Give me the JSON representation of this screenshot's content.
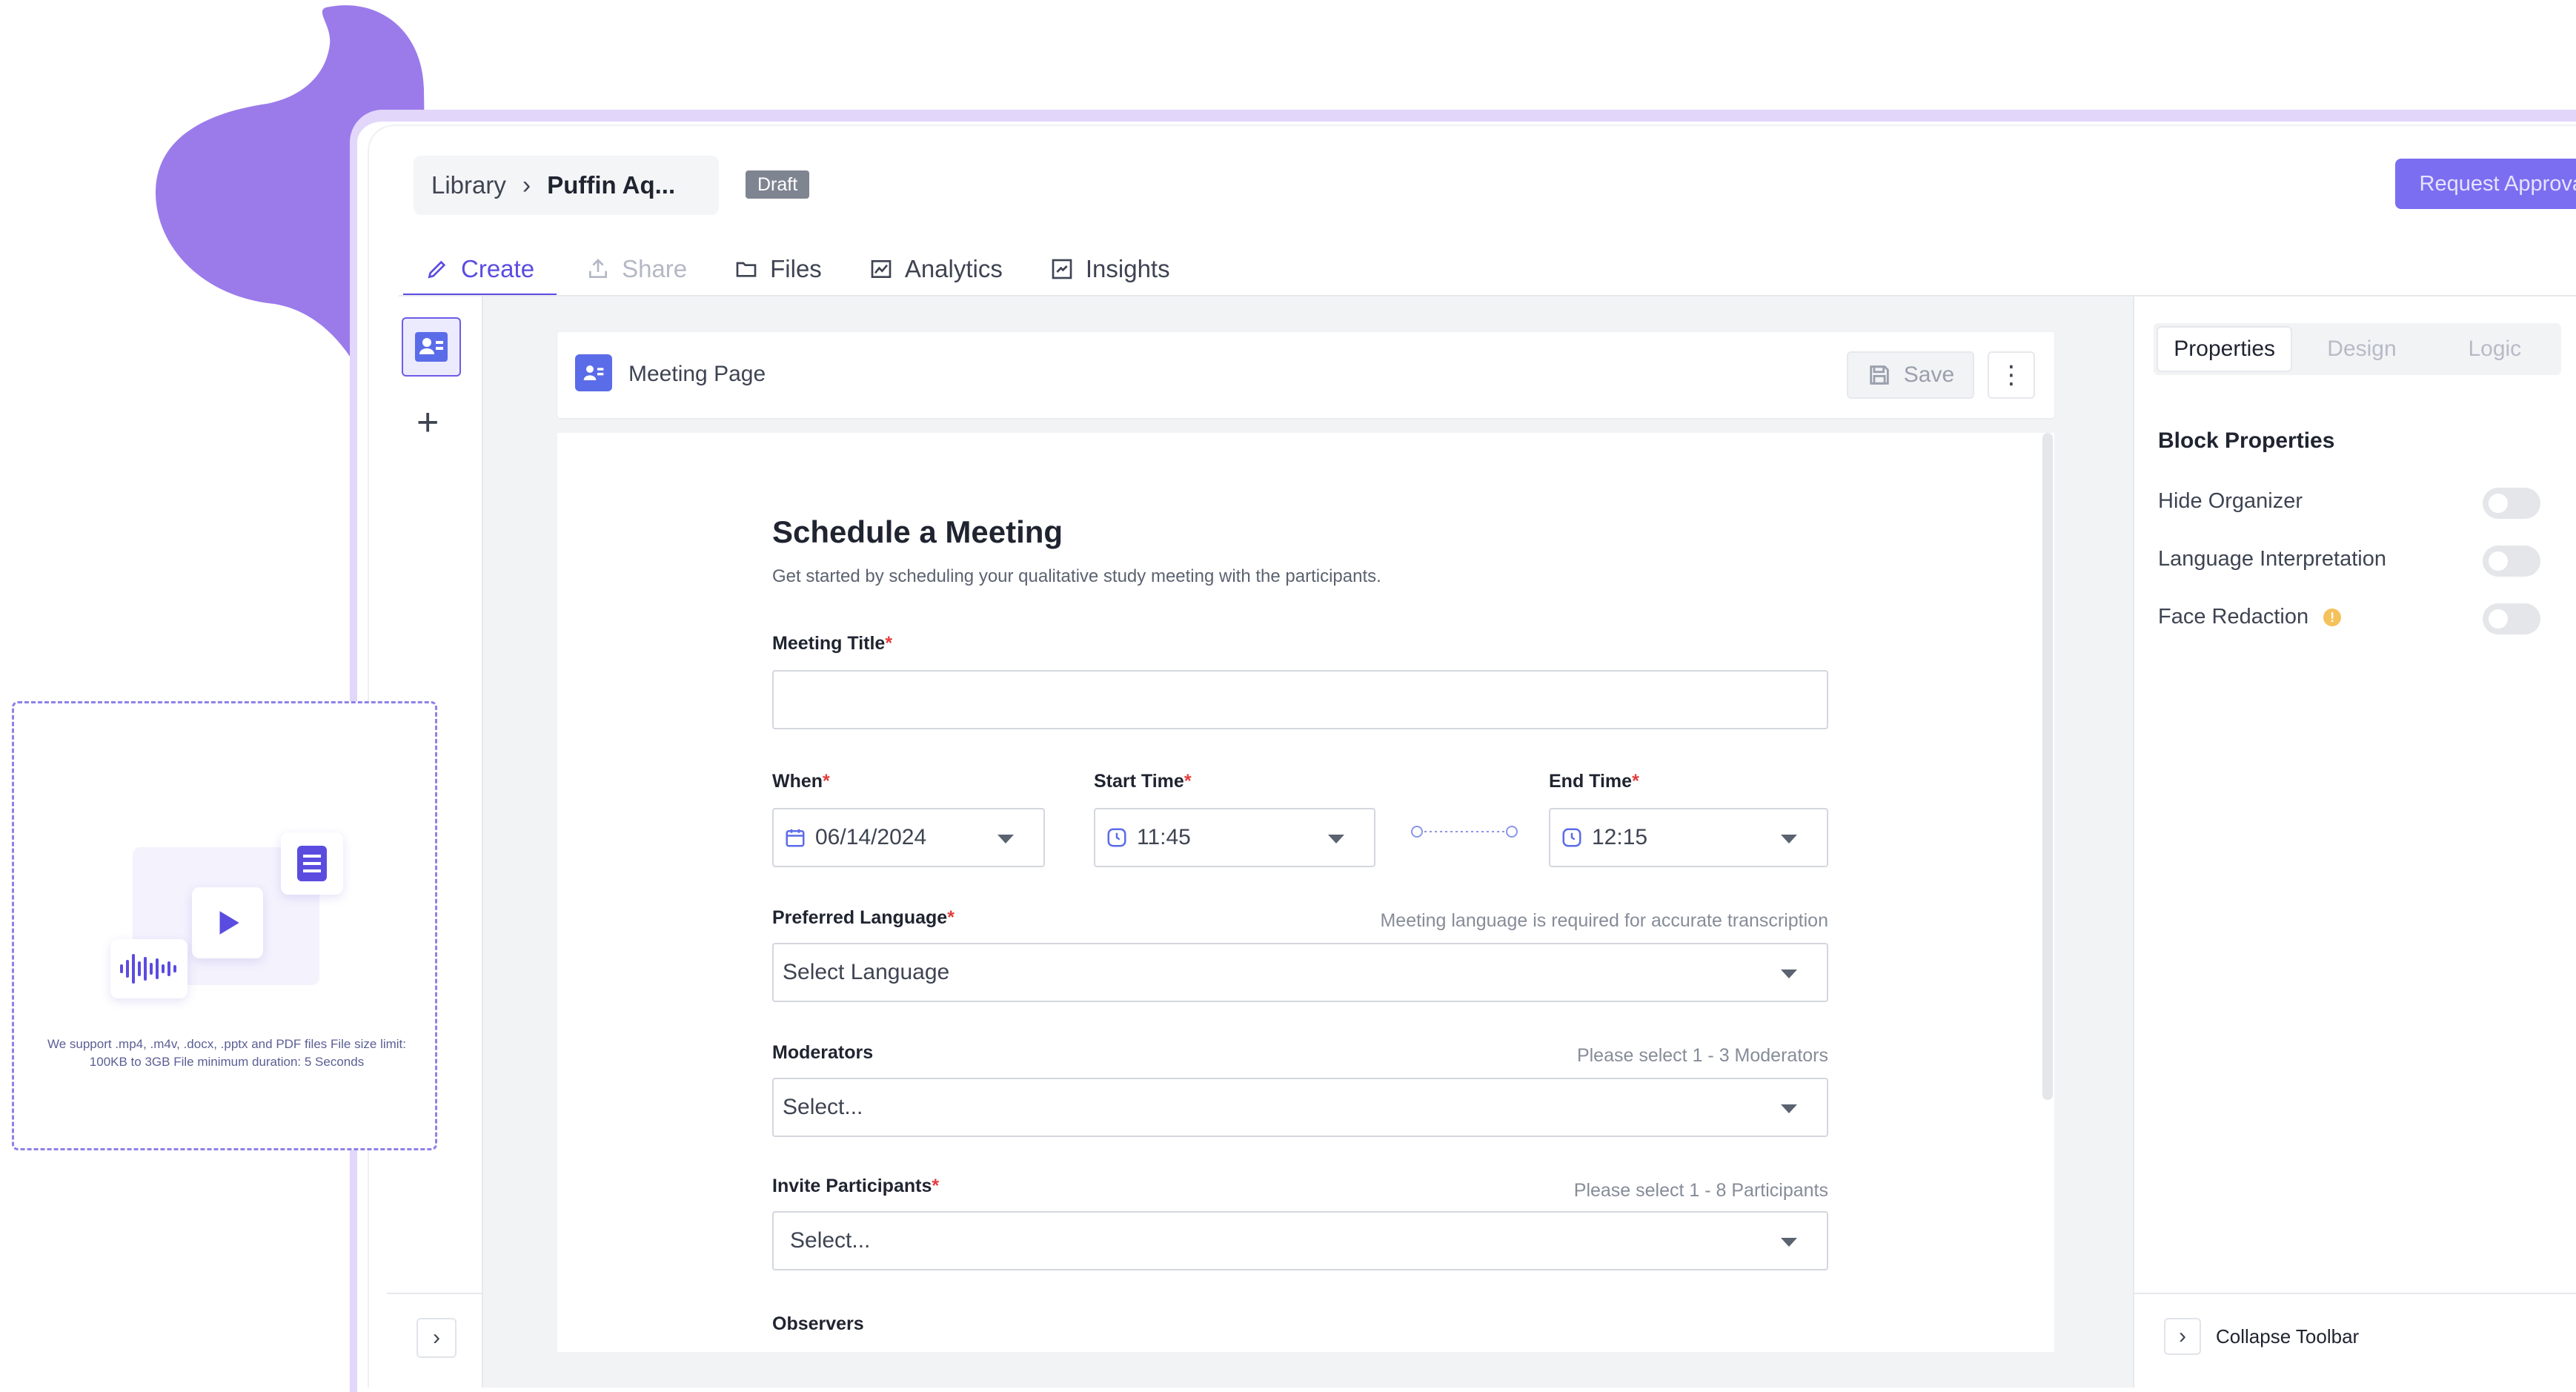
{
  "header": {
    "breadcrumb_root": "Library",
    "breadcrumb_current": "Puffin Aq...",
    "status_badge": "Draft",
    "request_approval_label": "Request Approval"
  },
  "tabs": [
    {
      "label": "Create",
      "icon": "pencil-icon",
      "state": "active"
    },
    {
      "label": "Share",
      "icon": "share-icon",
      "state": "disabled"
    },
    {
      "label": "Files",
      "icon": "folder-icon",
      "state": "normal"
    },
    {
      "label": "Analytics",
      "icon": "analytics-icon",
      "state": "normal"
    },
    {
      "label": "Insights",
      "icon": "insights-icon",
      "state": "normal"
    }
  ],
  "page_header": {
    "title": "Meeting Page",
    "save_label": "Save"
  },
  "form": {
    "title": "Schedule a Meeting",
    "subtitle": "Get started by scheduling your qualitative study meeting with the participants.",
    "meeting_title_label": "Meeting Title",
    "meeting_title_value": "",
    "when_label": "When",
    "when_value": "06/14/2024",
    "start_time_label": "Start Time",
    "start_time_value": "11:45",
    "end_time_label": "End Time",
    "end_time_value": "12:15",
    "language_label": "Preferred Language",
    "language_hint": "Meeting language is required for accurate transcription",
    "language_placeholder": "Select Language",
    "moderators_label": "Moderators",
    "moderators_hint": "Please select 1 - 3 Moderators",
    "moderators_placeholder": "Select...",
    "participants_label": "Invite Participants",
    "participants_hint": "Please select 1 - 8 Participants",
    "participants_placeholder": "Select...",
    "observers_label": "Observers",
    "required_mark": "*"
  },
  "right_panel": {
    "tabs": [
      "Properties",
      "Design",
      "Logic"
    ],
    "active_tab": "Properties",
    "section_title": "Block Properties",
    "properties": [
      {
        "label": "Hide Organizer",
        "on": false
      },
      {
        "label": "Language Interpretation",
        "on": false
      },
      {
        "label": "Face Redaction",
        "on": false,
        "info": true
      }
    ],
    "collapse_label": "Collapse Toolbar"
  },
  "upload_card": {
    "text": "We support .mp4, .m4v, .docx, .pptx and PDF files File size limit: 100KB to 3GB File minimum duration: 5 Seconds"
  },
  "colors": {
    "accent": "#5b4ce0",
    "button": "#7b6ef0",
    "blob": "#9b7bea",
    "required": "#e23d3d"
  }
}
